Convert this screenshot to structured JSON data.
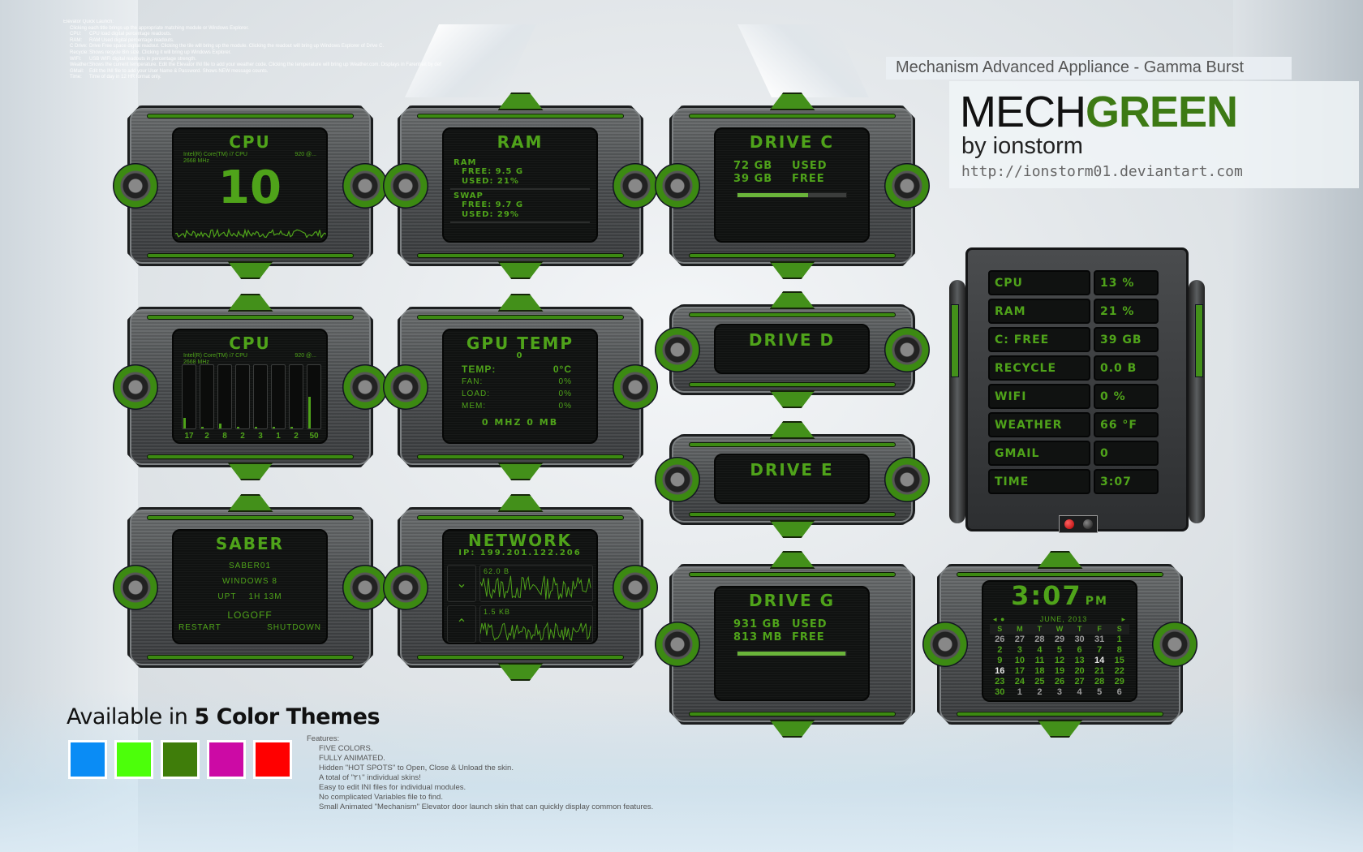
{
  "help": {
    "intro": "Elevator Quick Launch:",
    "note": "Clicking each title brings up the appropriate matching module or Windows Explorer.",
    "rows": [
      {
        "k": "CPU:",
        "v": "CPU load digital percentage readouts."
      },
      {
        "k": "RAM:",
        "v": "RAM Used digital percentage readouts."
      },
      {
        "k": "C Drive:",
        "v": "Drive Free space digital readout.  Clicking the tile will bring up the module.  Clicking the readout will bring up Windows Explorer of Drive C."
      },
      {
        "k": "Recycle:",
        "v": "Shows recycle Bin size.  Clicking it will bring up Windows Explorer."
      },
      {
        "k": "WIFI:",
        "v": "USB WIFI digital readouts in percentage strength."
      },
      {
        "k": "Weather:",
        "v": "Shows the current temperature.  Edit the Elevator INI file to add your weather code.  Clicking the temperature will bring up Weather.com.  Displays in Farenheit by def"
      },
      {
        "k": "GMail:",
        "v": "Edit the INI file to add your User Name & Password.  Shows NEW message counts."
      },
      {
        "k": "Time:",
        "v": "Time of day in 12 HR format only."
      }
    ]
  },
  "brand": {
    "subtitle": "Mechanism Advanced Appliance - Gamma Burst",
    "title_part1": "MECH",
    "title_part2": "GREEN",
    "author": "by ionstorm",
    "url": "http://ionstorm01.deviantart.com",
    "accent": "#3d7a14"
  },
  "cpu1": {
    "title": "CPU",
    "model": "Intel(R) Core(TM) i7 CPU",
    "model_suffix": "920 @...",
    "speed": "2668 MHz",
    "load": "10"
  },
  "ram": {
    "title": "RAM",
    "ram_label": "RAM",
    "ram_free": "FREE: 9.5 G",
    "ram_used": "USED: 21%",
    "swap_label": "SWAP",
    "swap_free": "FREE: 9.7 G",
    "swap_used": "USED: 29%"
  },
  "drive_c": {
    "title": "DRIVE C",
    "used_value": "72 GB",
    "used_label": "USED",
    "free_value": "39 GB",
    "free_label": "FREE",
    "used_fraction": 0.65
  },
  "cpu2": {
    "title": "CPU",
    "model": "Intel(R) Core(TM) i7 CPU",
    "model_suffix": "920 @...",
    "speed": "2668 MHz",
    "cores": [
      {
        "label": "17",
        "load": 0.17
      },
      {
        "label": "2",
        "load": 0.02
      },
      {
        "label": "8",
        "load": 0.08
      },
      {
        "label": "2",
        "load": 0.02
      },
      {
        "label": "3",
        "load": 0.03
      },
      {
        "label": "1",
        "load": 0.01
      },
      {
        "label": "2",
        "load": 0.02
      },
      {
        "label": "50",
        "load": 0.5
      }
    ]
  },
  "gpu": {
    "title": "GPU TEMP",
    "sub": "0",
    "rows": [
      {
        "k": "TEMP:",
        "v": "0°C",
        "big": true
      },
      {
        "k": "FAN:",
        "v": "0%"
      },
      {
        "k": "LOAD:",
        "v": "0%"
      },
      {
        "k": "MEM:",
        "v": "0%"
      }
    ],
    "footer": "0 MHZ 0 MB"
  },
  "drive_d": {
    "title": "DRIVE D"
  },
  "drive_e": {
    "title": "DRIVE E"
  },
  "saber": {
    "title": "SABER",
    "host": "SABER01",
    "os": "WINDOWS 8",
    "uptime_label": "UPT",
    "uptime": "1H 13M",
    "logoff": "LOGOFF",
    "restart": "RESTART",
    "shutdown": "SHUTDOWN"
  },
  "network": {
    "title": "NETWORK",
    "ip": "IP: 199.201.122.206",
    "down_label": "62.0 B",
    "up_label": "1.5 KB",
    "down_icon": "chevron-down-icon",
    "up_icon": "chevron-up-icon"
  },
  "drive_g": {
    "title": "DRIVE G",
    "used_value": "931 GB",
    "used_label": "USED",
    "free_value": "813 MB",
    "free_label": "FREE",
    "used_fraction": 0.99
  },
  "elevator": {
    "rows": [
      {
        "k": "CPU",
        "v": "13 %"
      },
      {
        "k": "RAM",
        "v": "21 %"
      },
      {
        "k": "C: FREE",
        "v": "39 GB"
      },
      {
        "k": "RECYCLE",
        "v": "0.0 B"
      },
      {
        "k": "WIFI",
        "v": "0 %"
      },
      {
        "k": "WEATHER",
        "v": "66 °F"
      },
      {
        "k": "GMAIL",
        "v": "0"
      },
      {
        "k": "TIME",
        "v": "3:07"
      }
    ]
  },
  "clock": {
    "time": "3:07",
    "ampm": "PM",
    "month": "JUNE, 2013",
    "prev": "◂ ●",
    "next": "▸",
    "dow": [
      "S",
      "M",
      "T",
      "W",
      "T",
      "F",
      "S"
    ],
    "weeks": [
      [
        {
          "d": "26",
          "o": 1
        },
        {
          "d": "27",
          "o": 1
        },
        {
          "d": "28",
          "o": 1
        },
        {
          "d": "29",
          "o": 1
        },
        {
          "d": "30",
          "o": 1
        },
        {
          "d": "31",
          "o": 1
        },
        {
          "d": "1"
        }
      ],
      [
        {
          "d": "2"
        },
        {
          "d": "3"
        },
        {
          "d": "4"
        },
        {
          "d": "5"
        },
        {
          "d": "6"
        },
        {
          "d": "7"
        },
        {
          "d": "8"
        }
      ],
      [
        {
          "d": "9"
        },
        {
          "d": "10"
        },
        {
          "d": "11"
        },
        {
          "d": "12"
        },
        {
          "d": "13"
        },
        {
          "d": "14",
          "t": 1
        },
        {
          "d": "15"
        }
      ],
      [
        {
          "d": "16",
          "t": 1
        },
        {
          "d": "17"
        },
        {
          "d": "18"
        },
        {
          "d": "19"
        },
        {
          "d": "20"
        },
        {
          "d": "21"
        },
        {
          "d": "22"
        }
      ],
      [
        {
          "d": "23"
        },
        {
          "d": "24"
        },
        {
          "d": "25"
        },
        {
          "d": "26"
        },
        {
          "d": "27"
        },
        {
          "d": "28"
        },
        {
          "d": "29"
        }
      ],
      [
        {
          "d": "30"
        },
        {
          "d": "1",
          "o": 1
        },
        {
          "d": "2",
          "o": 1
        },
        {
          "d": "3",
          "o": 1
        },
        {
          "d": "4",
          "o": 1
        },
        {
          "d": "5",
          "o": 1
        },
        {
          "d": "6",
          "o": 1
        }
      ]
    ]
  },
  "themes": {
    "title_light": "Available in ",
    "title_bold": "5 Color Themes",
    "colors": [
      "#0a8cf5",
      "#4cff0a",
      "#3f7d0a",
      "#cc0aa5",
      "#ff0000"
    ]
  },
  "features": {
    "heading": "Features:",
    "items": [
      "FIVE COLORS.",
      "FULLY ANIMATED.",
      "Hidden \"HOT SPOTS\" to Open, Close & Unload the skin.",
      "A total of \"٢١\" individual skins!",
      "Easy to edit INI files for individual modules.",
      "No complicated Variables file to find.",
      "Small Animated \"Mechanism\" Elevator door launch skin that can quickly display common features."
    ]
  }
}
